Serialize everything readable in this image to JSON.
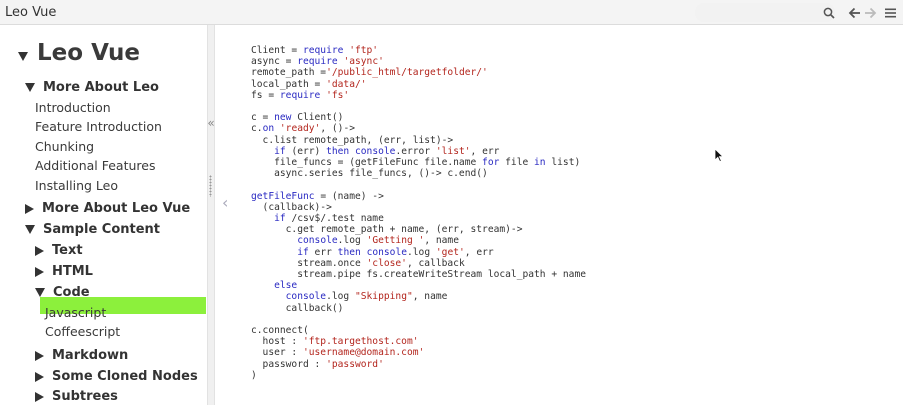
{
  "app": {
    "title": "Leo Vue"
  },
  "toolbar": {
    "search_icon": "search-icon",
    "back_icon": "arrow-left-icon",
    "forward_icon": "arrow-right-icon",
    "menu_icon": "hamburger-menu-icon"
  },
  "tree": {
    "root_label": "Leo Vue",
    "nodes": [
      {
        "label": "More About Leo",
        "expanded": true
      },
      {
        "label": "Introduction"
      },
      {
        "label": "Feature Introduction"
      },
      {
        "label": "Chunking"
      },
      {
        "label": "Additional Features"
      },
      {
        "label": "Installing Leo"
      },
      {
        "label": "More About Leo Vue",
        "expanded": false
      },
      {
        "label": "Sample Content",
        "expanded": true
      },
      {
        "label": "Text",
        "expanded": false
      },
      {
        "label": "HTML",
        "expanded": false
      },
      {
        "label": "Code",
        "expanded": true
      },
      {
        "label": "Javascript"
      },
      {
        "label": "Coffeescript",
        "selected": true
      },
      {
        "label": "Markdown",
        "expanded": false
      },
      {
        "label": "Some Cloned Nodes",
        "expanded": false
      },
      {
        "label": "Subtrees",
        "expanded": false
      }
    ]
  },
  "splitter": {
    "collapse_label": "«"
  },
  "content": {
    "back_chevron": "‹",
    "selected_color": "#8cf03c",
    "code_lines": [
      [
        [
          "t",
          "Client = "
        ],
        [
          "k",
          "require"
        ],
        [
          "t",
          " "
        ],
        [
          "s",
          "'ftp'"
        ]
      ],
      [
        [
          "t",
          "async = "
        ],
        [
          "k",
          "require"
        ],
        [
          "t",
          " "
        ],
        [
          "s",
          "'async'"
        ]
      ],
      [
        [
          "t",
          "remote_path ="
        ],
        [
          "s",
          "'/public_html/targetfolder/'"
        ]
      ],
      [
        [
          "t",
          "local_path = "
        ],
        [
          "s",
          "'data/'"
        ]
      ],
      [
        [
          "t",
          "fs = "
        ],
        [
          "k",
          "require"
        ],
        [
          "t",
          " "
        ],
        [
          "s",
          "'fs'"
        ]
      ],
      [],
      [
        [
          "t",
          "c = "
        ],
        [
          "k",
          "new"
        ],
        [
          "t",
          " Client()"
        ]
      ],
      [
        [
          "t",
          "c."
        ],
        [
          "k",
          "on"
        ],
        [
          "t",
          " "
        ],
        [
          "s",
          "'ready'"
        ],
        [
          "t",
          ", ()->"
        ]
      ],
      [
        [
          "t",
          "  c.list remote_path, (err, list)->"
        ]
      ],
      [
        [
          "t",
          "    "
        ],
        [
          "k",
          "if"
        ],
        [
          "t",
          " (err) "
        ],
        [
          "k",
          "then"
        ],
        [
          "t",
          " "
        ],
        [
          "k",
          "console"
        ],
        [
          "t",
          ".error "
        ],
        [
          "s",
          "'list'"
        ],
        [
          "t",
          ", err"
        ]
      ],
      [
        [
          "t",
          "    file_funcs = (getFileFunc file.name "
        ],
        [
          "k",
          "for"
        ],
        [
          "t",
          " file "
        ],
        [
          "k",
          "in"
        ],
        [
          "t",
          " list)"
        ]
      ],
      [
        [
          "t",
          "    async.series file_funcs, ()-> c.end()"
        ]
      ],
      [],
      [
        [
          "k",
          "getFileFunc"
        ],
        [
          "t",
          " = (name) ->"
        ]
      ],
      [
        [
          "t",
          "  (callback)->"
        ]
      ],
      [
        [
          "t",
          "    "
        ],
        [
          "k",
          "if"
        ],
        [
          "t",
          " /csv$/.test name"
        ]
      ],
      [
        [
          "t",
          "      c.get remote_path + name, (err, stream)->"
        ]
      ],
      [
        [
          "t",
          "        "
        ],
        [
          "k",
          "console"
        ],
        [
          "t",
          ".log "
        ],
        [
          "s",
          "'Getting '"
        ],
        [
          "t",
          ", name"
        ]
      ],
      [
        [
          "t",
          "        "
        ],
        [
          "k",
          "if"
        ],
        [
          "t",
          " err "
        ],
        [
          "k",
          "then"
        ],
        [
          "t",
          " "
        ],
        [
          "k",
          "console"
        ],
        [
          "t",
          ".log "
        ],
        [
          "s",
          "'get'"
        ],
        [
          "t",
          ", err"
        ]
      ],
      [
        [
          "t",
          "        stream.once "
        ],
        [
          "s",
          "'close'"
        ],
        [
          "t",
          ", callback"
        ]
      ],
      [
        [
          "t",
          "        stream.pipe fs.createWriteStream local_path + name"
        ]
      ],
      [
        [
          "t",
          "    "
        ],
        [
          "k",
          "else"
        ]
      ],
      [
        [
          "t",
          "      "
        ],
        [
          "k",
          "console"
        ],
        [
          "t",
          ".log "
        ],
        [
          "s",
          "\"Skipping\""
        ],
        [
          "t",
          ", name"
        ]
      ],
      [
        [
          "t",
          "      callback()"
        ]
      ],
      [],
      [
        [
          "t",
          "c.connect("
        ]
      ],
      [
        [
          "t",
          "  host : "
        ],
        [
          "s",
          "'ftp.targethost.com'"
        ]
      ],
      [
        [
          "t",
          "  user : "
        ],
        [
          "s",
          "'username@domain.com'"
        ]
      ],
      [
        [
          "t",
          "  password : "
        ],
        [
          "s",
          "'password'"
        ]
      ],
      [
        [
          "t",
          ")"
        ]
      ]
    ]
  }
}
